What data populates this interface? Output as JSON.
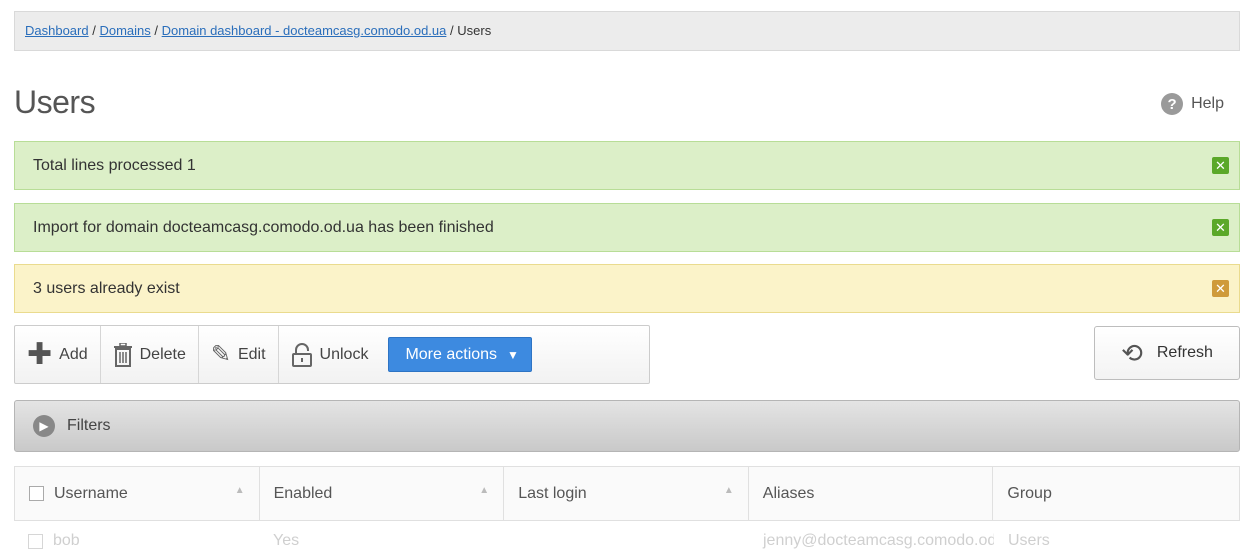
{
  "breadcrumb": {
    "items": [
      "Dashboard",
      "Domains",
      "Domain dashboard - docteamcasg.comodo.od.ua"
    ],
    "current": "Users",
    "separator": "/"
  },
  "page": {
    "title": "Users",
    "help_label": "Help",
    "help_glyph": "?"
  },
  "alerts": [
    {
      "text": "Total lines processed 1",
      "type": "success"
    },
    {
      "text": "Import for domain docteamcasg.comodo.od.ua has been finished",
      "type": "success"
    },
    {
      "text": "3 users already exist",
      "type": "warning"
    }
  ],
  "toolbar": {
    "add_label": "Add",
    "delete_label": "Delete",
    "edit_label": "Edit",
    "unlock_label": "Unlock",
    "more_actions_label": "More actions",
    "refresh_label": "Refresh"
  },
  "filters": {
    "label": "Filters"
  },
  "table": {
    "columns": [
      "Username",
      "Enabled",
      "Last login",
      "Aliases",
      "Group"
    ],
    "rows": [
      {
        "username": "bob",
        "enabled": "Yes",
        "last_login": "",
        "aliases": "jenny@docteamcasg.comodo.od.ua",
        "group": "Users"
      }
    ]
  },
  "colors": {
    "accent": "#3d8ae0",
    "success_bg": "#dcefc8",
    "warning_bg": "#fbf3c9",
    "link": "#2a6ebb"
  }
}
